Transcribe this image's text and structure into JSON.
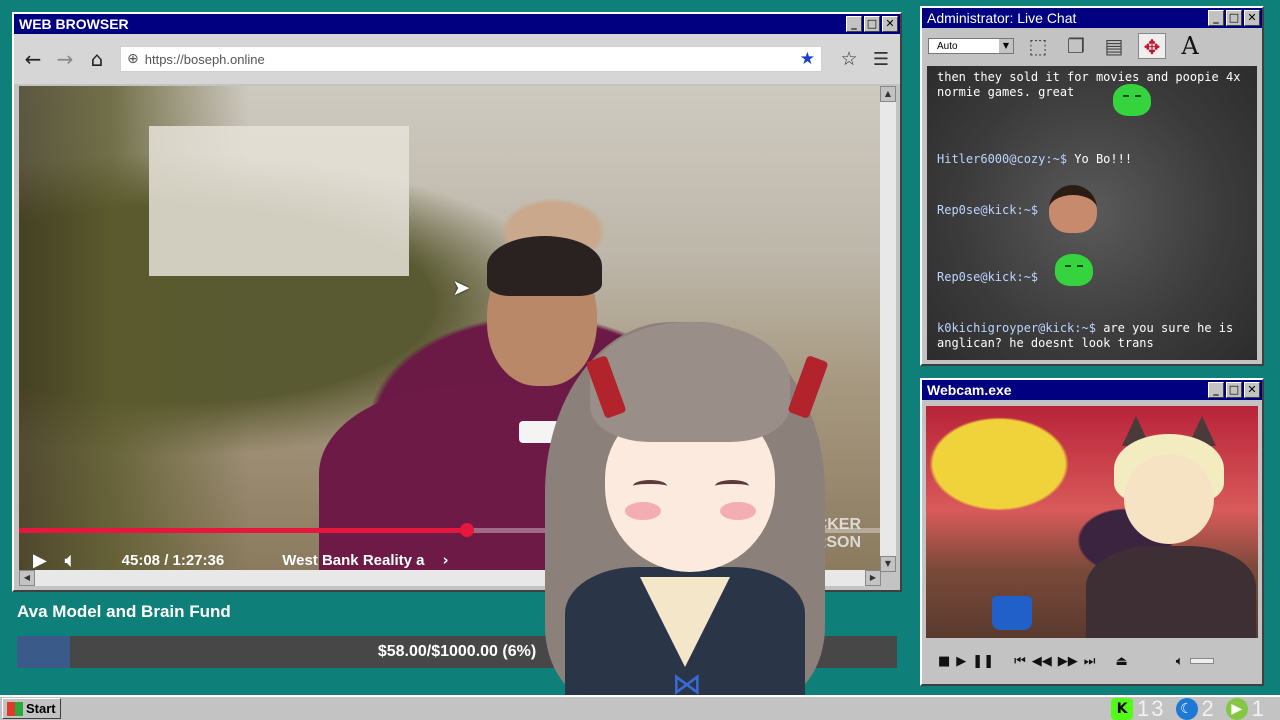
{
  "browser": {
    "title": "WEB BROWSER",
    "url": "https://boseph.online",
    "window_buttons": [
      "_",
      "□",
      "✕"
    ],
    "video": {
      "time": "45:08 / 1:27:36",
      "title": "West Bank Reality a",
      "progress_fraction": 0.52,
      "watermark": "UCKER\nRSON"
    }
  },
  "fund": {
    "title": "Ava Model and Brain Fund",
    "amount_text": "$58.00/$1000.00 (6%)",
    "percent": 6,
    "bar_color": "#3a5a8a"
  },
  "chat": {
    "title": "Administrator: Live Chat",
    "select_value": "Auto",
    "messages": [
      {
        "user": "",
        "text": "then they sold it for movies and poopie 4x normie games. great",
        "emote": "green-blob"
      },
      {
        "user": "Hitler6000@cozy:~$",
        "text": "Yo Bo!!!",
        "emote": ""
      },
      {
        "user": "Rep0se@kick:~$",
        "text": "",
        "emote": "face"
      },
      {
        "user": "Rep0se@kick:~$",
        "text": "",
        "emote": "green-blob"
      },
      {
        "user": "k0kichigroyper@kick:~$",
        "text": "are you sure he is anglican? he doesnt look trans",
        "emote": ""
      }
    ]
  },
  "webcam": {
    "title": "Webcam.exe"
  },
  "taskbar": {
    "start_label": "Start",
    "tray": [
      {
        "icon": "kick-icon",
        "count": "13"
      },
      {
        "icon": "moon-icon",
        "count": "2"
      },
      {
        "icon": "rumble-icon",
        "count": "1"
      }
    ]
  },
  "colors": {
    "desktop": "#0f7f7a",
    "titlebar": "#000080",
    "accent_red": "#e6173c"
  }
}
